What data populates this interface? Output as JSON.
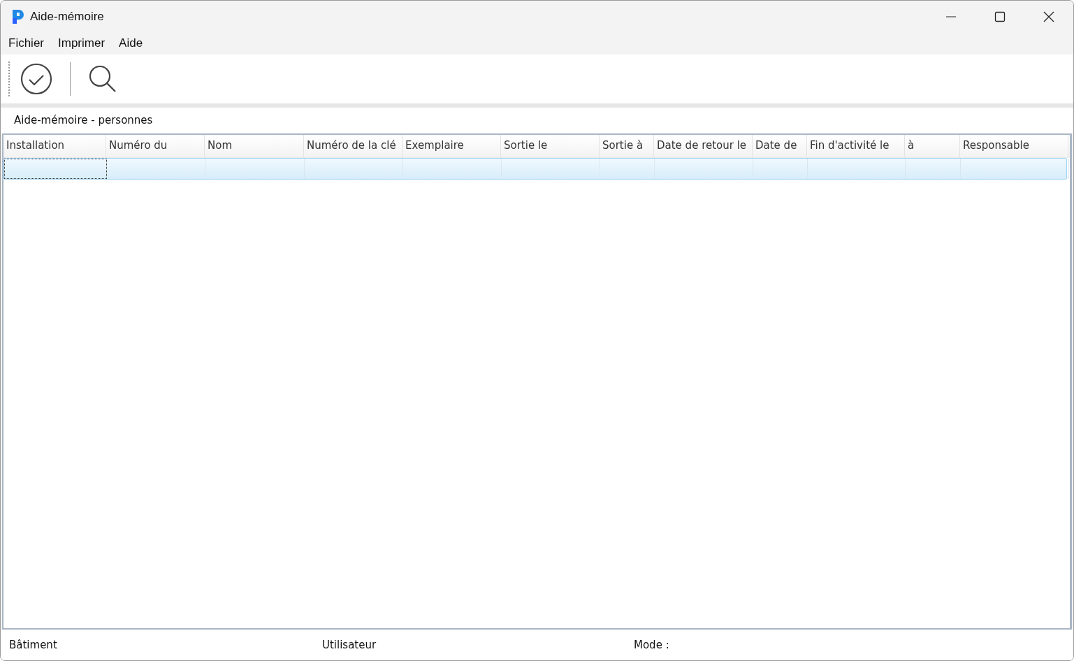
{
  "window": {
    "title": "Aide-mémoire"
  },
  "menu": [
    {
      "label": "Fichier"
    },
    {
      "label": "Imprimer"
    },
    {
      "label": "Aide"
    }
  ],
  "toolbar": [
    {
      "kind": "confirm"
    },
    {
      "kind": "search"
    }
  ],
  "panel": {
    "title": "Aide-mémoire - personnes"
  },
  "table": {
    "columns": [
      "Installation",
      "Numéro du",
      "Nom",
      "Numéro de la clé",
      "Exemplaire",
      "Sortie le",
      "Sortie à",
      "Date de retour le",
      "Date de",
      "Fin d'activité le",
      "à",
      "Responsable"
    ],
    "rows": [
      {
        "selected": true
      }
    ]
  },
  "status_bar": {
    "building": "Bâtiment",
    "user": "Utilisateur",
    "mode": "Mode :"
  }
}
